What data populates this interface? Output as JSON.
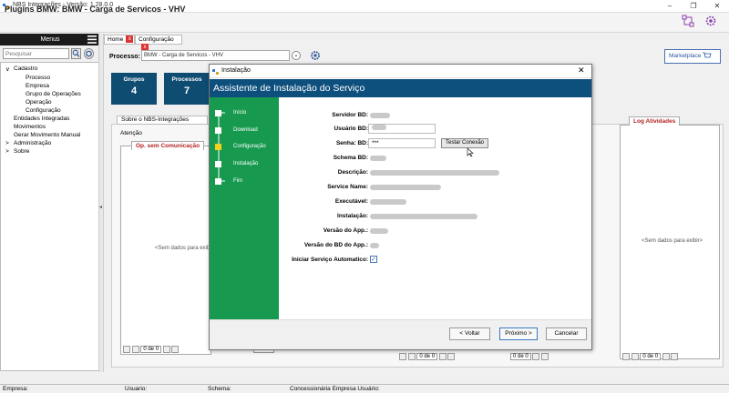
{
  "window": {
    "title": "NBS Integrações - Versão: 1.28.0.0",
    "controls": [
      "–",
      "❐",
      "✕"
    ]
  },
  "header": {
    "title": "Plugins BMW: BMW - Carga de Servicos - VHV"
  },
  "sidebar": {
    "menu_label": "Menus",
    "search_placeholder": "Pesquisar",
    "tree": [
      {
        "label": "Cadastro",
        "expander": "∨"
      },
      {
        "label": "Processo"
      },
      {
        "label": "Empresa"
      },
      {
        "label": "Grupo de Operações"
      },
      {
        "label": "Operação"
      },
      {
        "label": "Configuração"
      },
      {
        "label": "Entidades Integradas"
      },
      {
        "label": "Movimentos"
      },
      {
        "label": "Gerar Movimento Manual"
      },
      {
        "label": "Administração",
        "expander": ">"
      },
      {
        "label": "Sobre",
        "expander": ">"
      }
    ]
  },
  "tabs": [
    {
      "label": "Home",
      "close": "x"
    },
    {
      "label": "Configuração",
      "close": "x"
    }
  ],
  "toolbar": {
    "process_label": "Processo:",
    "process_value": "BMW - Carga de Servicos - VHV",
    "marketplace_label": "Marketplace"
  },
  "cards": [
    {
      "label": "Grupos",
      "value": "4"
    },
    {
      "label": "Processos",
      "value": "7"
    }
  ],
  "main": {
    "about_tab": "Sobre o NBS-Integrações",
    "attention_label": "Atenção",
    "panel_left_tab": "Op. sem Comunicação",
    "panel_right_tab": "Log Atividades",
    "empty_text": "<Sem dados para exibir>",
    "pager_text": "0 de 0"
  },
  "status": {
    "empresa": "Empresa:",
    "usuario": "Usuario:",
    "schema": "Schema:",
    "concessionaria": "Concessionária Empresa Usuário:"
  },
  "dialog": {
    "title": "Instalação",
    "close": "✕",
    "heading": "Assistente de Instalação do Serviço",
    "steps": [
      "Início",
      "Download",
      "Configuração",
      "Instalação",
      "Fim"
    ],
    "labels": {
      "servidor": "Servidor BD:",
      "usuario": "Usuário BD:",
      "senha": "Senha: BD:",
      "schema": "Schema BD:",
      "descricao": "Descrição:",
      "service_name": "Service Name:",
      "executavel": "Executável:",
      "instalacao": "Instalação:",
      "versao_app": "Versão do App.:",
      "versao_bd": "Versão do BD do App.:",
      "iniciar": "Iniciar Serviço Automatico:"
    },
    "password_value": "***",
    "test_button": "Testar Conexão",
    "checkbox_mark": "✓",
    "buttons": {
      "back": "< Voltar",
      "next": "Próximo >",
      "cancel": "Cancelar"
    }
  },
  "colors": {
    "banner": "#0d4f7d",
    "steps_panel": "#179a4f",
    "card": "#0f4c71",
    "tab_close": "#dd3333"
  }
}
